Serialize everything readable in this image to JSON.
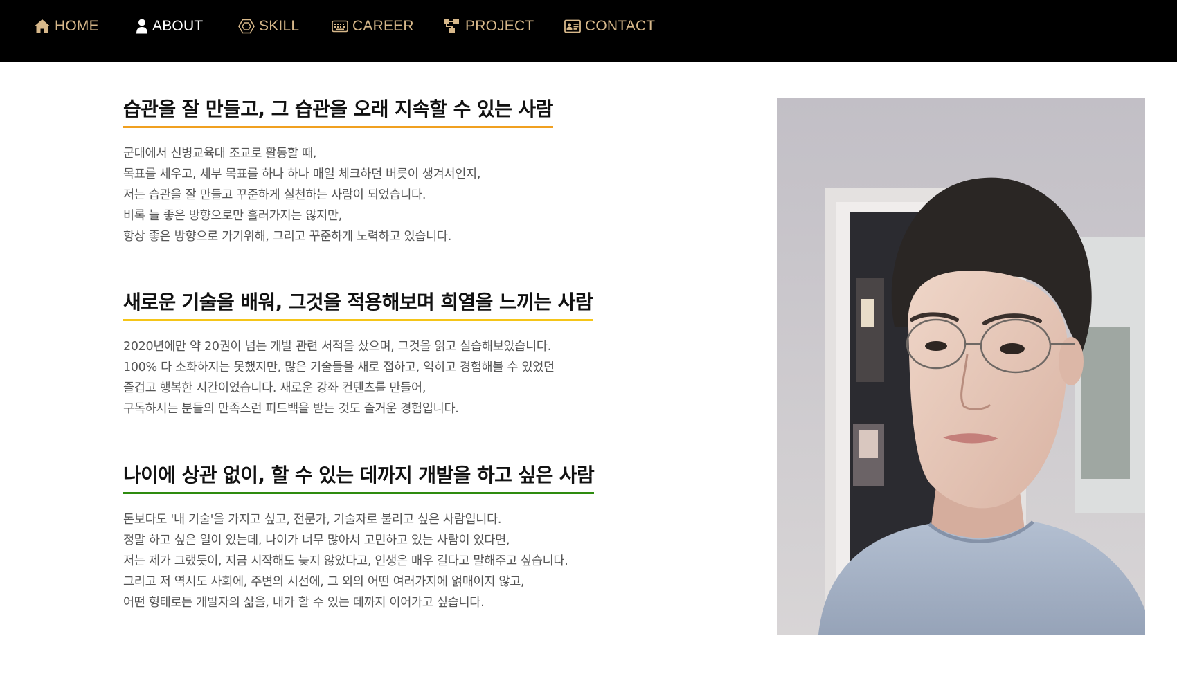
{
  "nav": {
    "text_color": "#D7B88A",
    "items": [
      {
        "label": "HOME",
        "icon": "home-icon",
        "color": "#D7B88A"
      },
      {
        "label": "ABOUT",
        "icon": "user-icon",
        "color": "#FFFFFF"
      },
      {
        "label": "SKILL",
        "icon": "hexagon-icon",
        "color": "#D7B88A"
      },
      {
        "label": "CAREER",
        "icon": "keyboard-icon",
        "color": "#D7B88A"
      },
      {
        "label": "PROJECT",
        "icon": "sitemap-icon",
        "color": "#D7B88A"
      },
      {
        "label": "CONTACT",
        "icon": "contact-card-icon",
        "color": "#D7B88A"
      }
    ]
  },
  "sections": [
    {
      "title": "습관을 잘 만들고, 그 습관을 오래 지속할 수 있는 사람",
      "underline_color": "#F0A020",
      "lines": [
        "군대에서 신병교육대 조교로 활동할 때,",
        "목표를 세우고, 세부 목표를 하나 하나 매일 체크하던 버릇이 생겨서인지,",
        "저는 습관을 잘 만들고 꾸준하게 실천하는 사람이 되었습니다.",
        "비록 늘 좋은 방향으로만 흘러가지는 않지만,",
        "항상 좋은 방향으로 가기위해, 그리고 꾸준하게 노력하고 있습니다."
      ]
    },
    {
      "title": "새로운 기술을 배워, 그것을 적용해보며 희열을 느끼는 사람",
      "underline_color": "#F5C518",
      "lines": [
        "2020년에만 약 20권이 넘는 개발 관련 서적을 샀으며, 그것을 읽고 실습해보았습니다.",
        "100% 다 소화하지는 못했지만, 많은 기술들을 새로 접하고, 익히고 경험해볼 수 있었던",
        "즐겁고 행복한 시간이었습니다. 새로운 강좌 컨텐츠를 만들어,",
        "구독하시는 분들의 만족스런 피드백을 받는 것도 즐거운 경험입니다."
      ]
    },
    {
      "title": "나이에 상관 없이, 할 수 있는 데까지 개발을 하고 싶은 사람",
      "underline_color": "#2E8B0F",
      "lines": [
        "돈보다도 '내 기술'을 가지고 싶고, 전문가, 기술자로 불리고 싶은 사람입니다.",
        "정말 하고 싶은 일이 있는데, 나이가 너무 많아서 고민하고 있는 사람이 있다면,",
        "저는 제가 그랬듯이, 지금 시작해도 늦지 않았다고, 인생은 매우 길다고 말해주고 싶습니다.",
        "그리고 저 역시도 사회에, 주변의 시선에, 그 외의 어떤 여러가지에 얽매이지 않고,",
        "어떤 형태로든 개발자의 삶을, 내가 할 수 있는 데까지 이어가고 싶습니다."
      ]
    }
  ]
}
